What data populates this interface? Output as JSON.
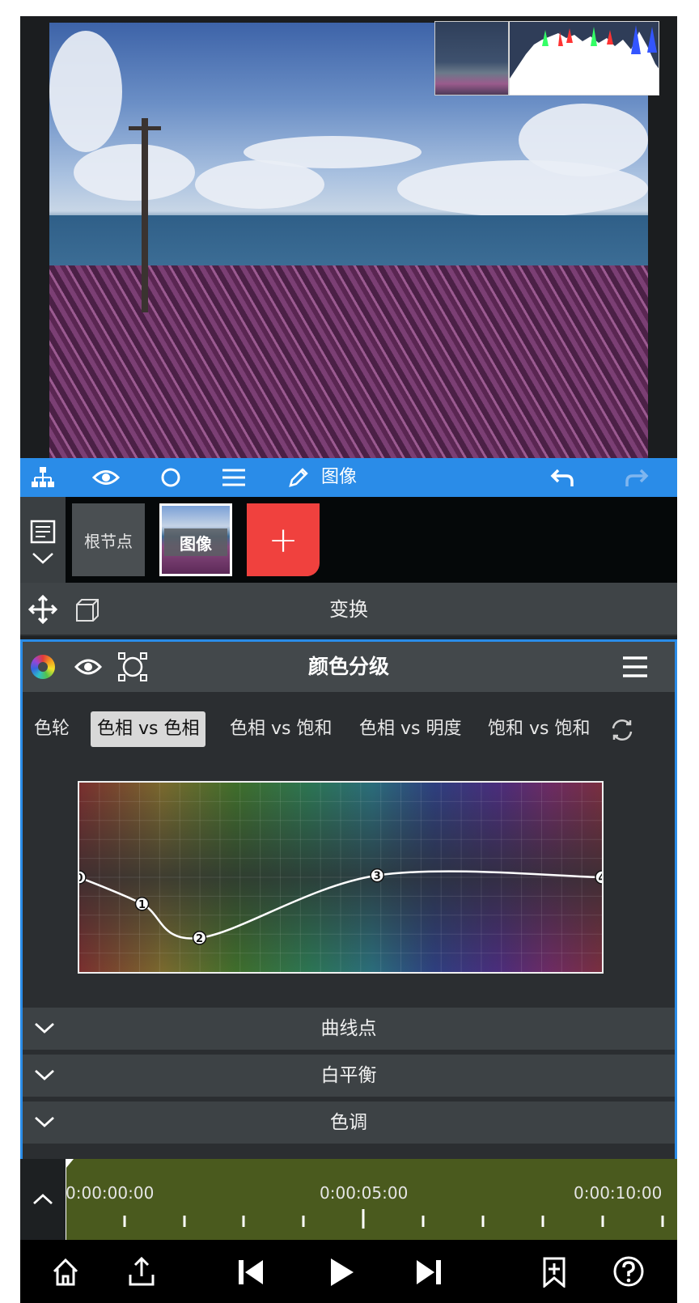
{
  "toolbar": {
    "node_label": "图像",
    "icons": [
      "hierarchy-icon",
      "eye-icon",
      "circle-icon",
      "menu-icon",
      "pencil-icon",
      "undo-icon",
      "redo-icon"
    ]
  },
  "layers": {
    "root_node": "根节点",
    "image_node": "图像",
    "add_label": "+"
  },
  "transform": {
    "title": "变换"
  },
  "color_panel": {
    "title": "颜色分级",
    "tabs": [
      {
        "label": "色轮",
        "active": false
      },
      {
        "label": "色相 vs 色相",
        "active": true
      },
      {
        "label": "色相 vs 饱和",
        "active": false
      },
      {
        "label": "色相 vs 明度",
        "active": false
      },
      {
        "label": "饱和 vs 饱和",
        "active": false
      }
    ],
    "curve_points": [
      {
        "label": "0",
        "hue": 0.0,
        "value": 0.5
      },
      {
        "label": "1",
        "hue": 0.12,
        "value": 0.36
      },
      {
        "label": "2",
        "hue": 0.23,
        "value": 0.18
      },
      {
        "label": "3",
        "hue": 0.57,
        "value": 0.51
      },
      {
        "label": "4",
        "hue": 1.0,
        "value": 0.5
      }
    ],
    "sections": [
      "曲线点",
      "白平衡",
      "色调"
    ]
  },
  "timeline": {
    "timecodes": [
      "0:00:00:00",
      "0:00:05:00",
      "0:00:10:00"
    ]
  },
  "colors": {
    "accent": "#2a8ce8",
    "add_button": "#f0413e",
    "timeline_track": "#4a5a1e"
  }
}
